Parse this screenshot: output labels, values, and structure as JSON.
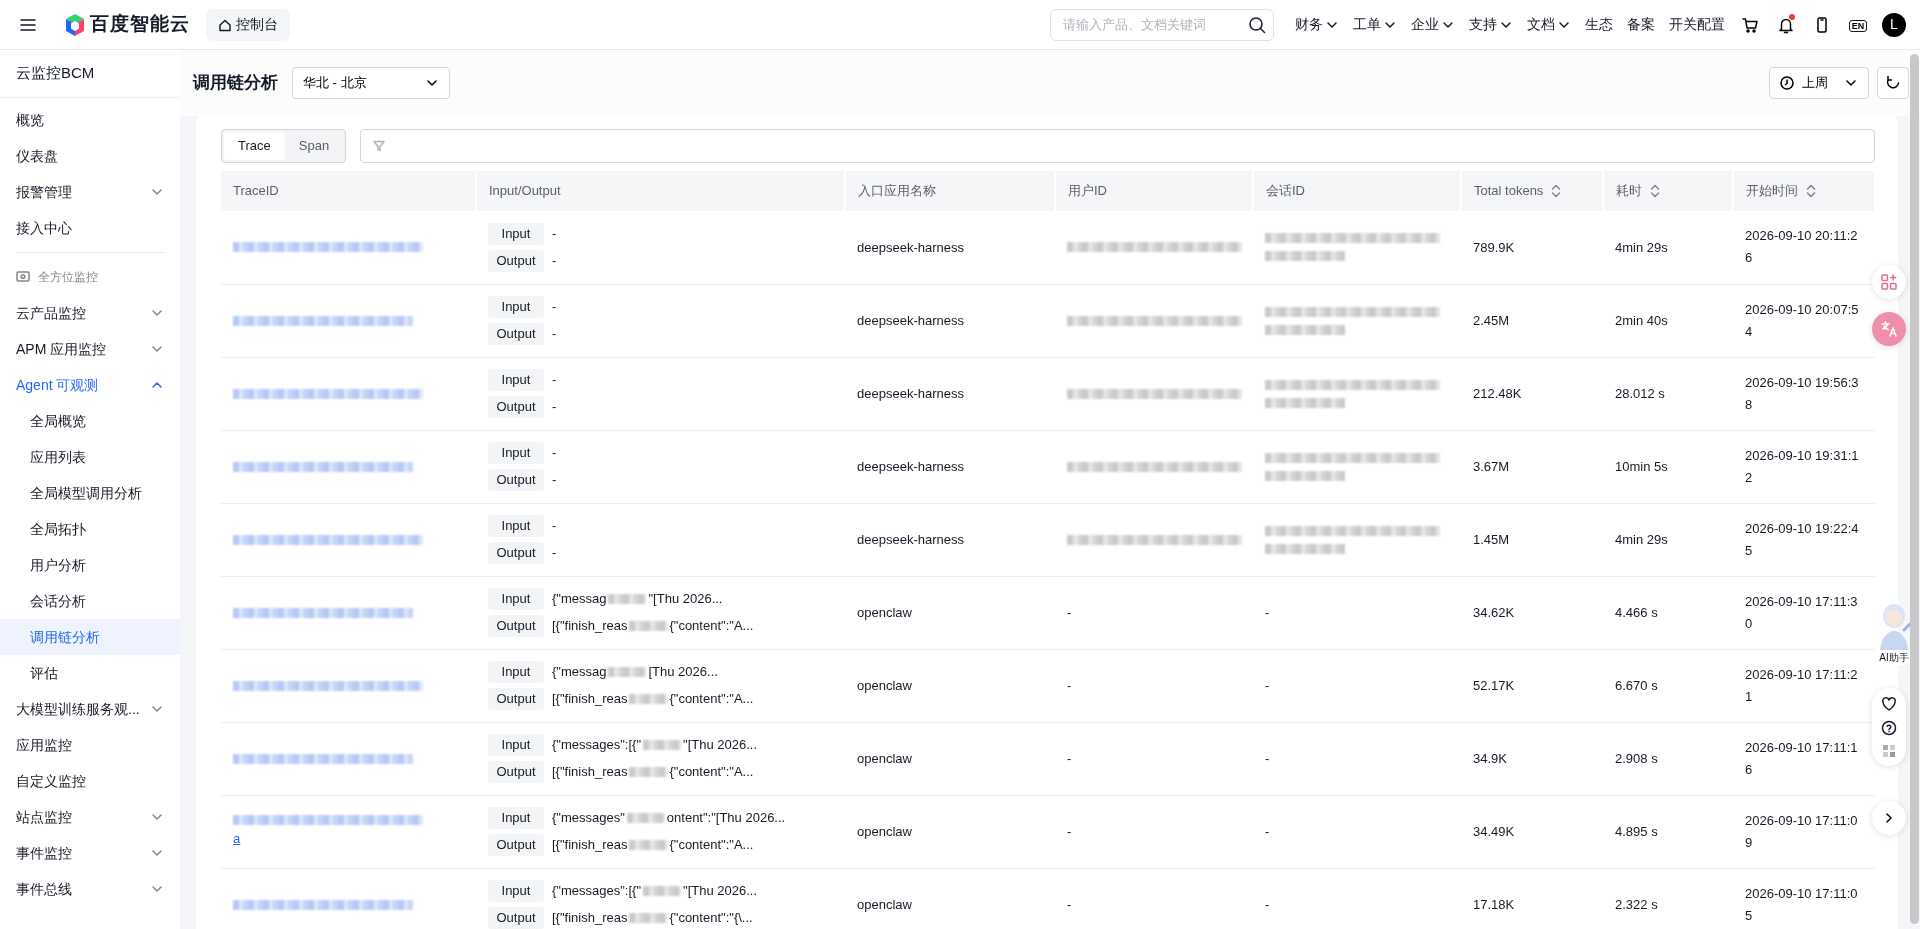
{
  "topbar": {
    "logo": "百度智能云",
    "console": "控制台",
    "search": {
      "placeholder": "请输入产品、文档关键词"
    },
    "menu": [
      {
        "label": "财务",
        "dropdown": true
      },
      {
        "label": "工单",
        "dropdown": true
      },
      {
        "label": "企业",
        "dropdown": true
      },
      {
        "label": "支持",
        "dropdown": true
      },
      {
        "label": "文档",
        "dropdown": true
      },
      {
        "label": "生态",
        "dropdown": false
      },
      {
        "label": "备案",
        "dropdown": false
      },
      {
        "label": "开关配置",
        "dropdown": false
      }
    ],
    "notifications_unread": true,
    "lang": "EN",
    "avatar": "L"
  },
  "sidebar": {
    "title": "云监控BCM",
    "items": [
      {
        "kind": "item",
        "label": "概览",
        "selected": false
      },
      {
        "kind": "item",
        "label": "仪表盘",
        "selected": false
      },
      {
        "kind": "group",
        "label": "报警管理",
        "selected": false,
        "expanded": false
      },
      {
        "kind": "item",
        "label": "接入中心",
        "selected": false
      },
      {
        "kind": "divider"
      },
      {
        "kind": "section",
        "label": "全方位监控"
      },
      {
        "kind": "group",
        "label": "云产品监控",
        "selected": false,
        "expanded": false
      },
      {
        "kind": "group",
        "label": "APM 应用监控",
        "selected": false,
        "expanded": false
      },
      {
        "kind": "group",
        "label": "Agent 可观测",
        "selected": false,
        "expanded": true,
        "children": [
          {
            "label": "全局概览",
            "selected": false
          },
          {
            "label": "应用列表",
            "selected": false
          },
          {
            "label": "全局模型调用分析",
            "selected": false
          },
          {
            "label": "全局拓扑",
            "selected": false
          },
          {
            "label": "用户分析",
            "selected": false
          },
          {
            "label": "会话分析",
            "selected": false
          },
          {
            "label": "调用链分析",
            "selected": true
          },
          {
            "label": "评估",
            "selected": false
          }
        ]
      },
      {
        "kind": "group",
        "label": "大模型训练服务观...",
        "selected": false,
        "expanded": false
      },
      {
        "kind": "item",
        "label": "应用监控",
        "selected": false
      },
      {
        "kind": "item",
        "label": "自定义监控",
        "selected": false
      },
      {
        "kind": "group",
        "label": "站点监控",
        "selected": false,
        "expanded": false
      },
      {
        "kind": "group",
        "label": "事件监控",
        "selected": false,
        "expanded": false
      },
      {
        "kind": "group",
        "label": "事件总线",
        "selected": false,
        "expanded": false
      }
    ]
  },
  "header": {
    "title": "调用链分析",
    "region": "华北 - 北京",
    "time_range": "上周"
  },
  "tabs": [
    {
      "label": "Trace",
      "selected": true
    },
    {
      "label": "Span",
      "selected": false
    }
  ],
  "table": {
    "columns": [
      {
        "label": "TraceID",
        "sortable": false
      },
      {
        "label": "Input/Output",
        "sortable": false
      },
      {
        "label": "入口应用名称",
        "sortable": false
      },
      {
        "label": "用户ID",
        "sortable": false
      },
      {
        "label": "会话ID",
        "sortable": false
      },
      {
        "label": "Total tokens",
        "sortable": true
      },
      {
        "label": "耗时",
        "sortable": true
      },
      {
        "label": "开始时间",
        "sortable": true
      }
    ],
    "rows": [
      {
        "io": [
          {
            "label": "Input",
            "segments": [
              {
                "kind": "text",
                "text": "-"
              }
            ]
          },
          {
            "label": "Output",
            "segments": [
              {
                "kind": "text",
                "text": "-"
              }
            ]
          }
        ],
        "app": "deepseek-harness",
        "user_id": {
          "kind": "blur"
        },
        "session_id": {
          "kind": "blur"
        },
        "tokens": "789.9K",
        "duration": "4min 29s",
        "start": "2026-09-10 20:11:26"
      },
      {
        "io": [
          {
            "label": "Input",
            "segments": [
              {
                "kind": "text",
                "text": "-"
              }
            ]
          },
          {
            "label": "Output",
            "segments": [
              {
                "kind": "text",
                "text": "-"
              }
            ]
          }
        ],
        "app": "deepseek-harness",
        "user_id": {
          "kind": "blur"
        },
        "session_id": {
          "kind": "blur"
        },
        "tokens": "2.45M",
        "duration": "2min 40s",
        "start": "2026-09-10 20:07:54"
      },
      {
        "io": [
          {
            "label": "Input",
            "segments": [
              {
                "kind": "text",
                "text": "-"
              }
            ]
          },
          {
            "label": "Output",
            "segments": [
              {
                "kind": "text",
                "text": "-"
              }
            ]
          }
        ],
        "app": "deepseek-harness",
        "user_id": {
          "kind": "blur"
        },
        "session_id": {
          "kind": "blur"
        },
        "tokens": "212.48K",
        "duration": "28.012 s",
        "start": "2026-09-10 19:56:38"
      },
      {
        "io": [
          {
            "label": "Input",
            "segments": [
              {
                "kind": "text",
                "text": "-"
              }
            ]
          },
          {
            "label": "Output",
            "segments": [
              {
                "kind": "text",
                "text": "-"
              }
            ]
          }
        ],
        "app": "deepseek-harness",
        "user_id": {
          "kind": "blur"
        },
        "session_id": {
          "kind": "blur"
        },
        "tokens": "3.67M",
        "duration": "10min 5s",
        "start": "2026-09-10 19:31:12"
      },
      {
        "io": [
          {
            "label": "Input",
            "segments": [
              {
                "kind": "text",
                "text": "-"
              }
            ]
          },
          {
            "label": "Output",
            "segments": [
              {
                "kind": "text",
                "text": "-"
              }
            ]
          }
        ],
        "app": "deepseek-harness",
        "user_id": {
          "kind": "blur"
        },
        "session_id": {
          "kind": "blur"
        },
        "tokens": "1.45M",
        "duration": "4min 29s",
        "start": "2026-09-10 19:22:45"
      },
      {
        "io": [
          {
            "label": "Input",
            "segments": [
              {
                "kind": "text",
                "text": "{\"messag"
              },
              {
                "kind": "blur"
              },
              {
                "kind": "text",
                "text": "\"[Thu 2026..."
              }
            ]
          },
          {
            "label": "Output",
            "segments": [
              {
                "kind": "text",
                "text": "[{\"finish_reas"
              },
              {
                "kind": "blur"
              },
              {
                "kind": "text",
                "text": "{\"content\":\"A..."
              }
            ]
          }
        ],
        "app": "openclaw",
        "user_id": {
          "kind": "text",
          "text": "-"
        },
        "session_id": {
          "kind": "text",
          "text": "-"
        },
        "tokens": "34.62K",
        "duration": "4.466 s",
        "start": "2026-09-10 17:11:30"
      },
      {
        "io": [
          {
            "label": "Input",
            "segments": [
              {
                "kind": "text",
                "text": "{\"messag"
              },
              {
                "kind": "blur"
              },
              {
                "kind": "text",
                "text": "[Thu 2026..."
              }
            ]
          },
          {
            "label": "Output",
            "segments": [
              {
                "kind": "text",
                "text": "[{\"finish_reas"
              },
              {
                "kind": "blur"
              },
              {
                "kind": "text",
                "text": "{\"content\":\"A..."
              }
            ]
          }
        ],
        "app": "openclaw",
        "user_id": {
          "kind": "text",
          "text": "-"
        },
        "session_id": {
          "kind": "text",
          "text": "-"
        },
        "tokens": "52.17K",
        "duration": "6.670 s",
        "start": "2026-09-10 17:11:21"
      },
      {
        "io": [
          {
            "label": "Input",
            "segments": [
              {
                "kind": "text",
                "text": "{\"messages\":[{\""
              },
              {
                "kind": "blur"
              },
              {
                "kind": "text",
                "text": "\"[Thu 2026..."
              }
            ]
          },
          {
            "label": "Output",
            "segments": [
              {
                "kind": "text",
                "text": "[{\"finish_reas"
              },
              {
                "kind": "blur"
              },
              {
                "kind": "text",
                "text": "{\"content\":\"A..."
              }
            ]
          }
        ],
        "app": "openclaw",
        "user_id": {
          "kind": "text",
          "text": "-"
        },
        "session_id": {
          "kind": "text",
          "text": "-"
        },
        "tokens": "34.9K",
        "duration": "2.908 s",
        "start": "2026-09-10 17:11:16"
      },
      {
        "trace_tail": "a",
        "io": [
          {
            "label": "Input",
            "segments": [
              {
                "kind": "text",
                "text": "{\"messages\""
              },
              {
                "kind": "blur"
              },
              {
                "kind": "text",
                "text": "ontent\":\"[Thu 2026..."
              }
            ]
          },
          {
            "label": "Output",
            "segments": [
              {
                "kind": "text",
                "text": "[{\"finish_reas"
              },
              {
                "kind": "blur"
              },
              {
                "kind": "text",
                "text": "{\"content\":\"A..."
              }
            ]
          }
        ],
        "app": "openclaw",
        "user_id": {
          "kind": "text",
          "text": "-"
        },
        "session_id": {
          "kind": "text",
          "text": "-"
        },
        "tokens": "34.49K",
        "duration": "4.895 s",
        "start": "2026-09-10 17:11:09"
      },
      {
        "io": [
          {
            "label": "Input",
            "segments": [
              {
                "kind": "text",
                "text": "{\"messages\":[{\""
              },
              {
                "kind": "blur"
              },
              {
                "kind": "text",
                "text": "\"[Thu 2026..."
              }
            ]
          },
          {
            "label": "Output",
            "segments": [
              {
                "kind": "text",
                "text": "[{\"finish_reas"
              },
              {
                "kind": "blur"
              },
              {
                "kind": "text",
                "text": "{\"content\":\"{\\..."
              }
            ]
          }
        ],
        "app": "openclaw",
        "user_id": {
          "kind": "text",
          "text": "-"
        },
        "session_id": {
          "kind": "text",
          "text": "-"
        },
        "tokens": "17.18K",
        "duration": "2.322 s",
        "start": "2026-09-10 17:11:05"
      }
    ]
  },
  "assistant": {
    "label": "AI助手"
  }
}
